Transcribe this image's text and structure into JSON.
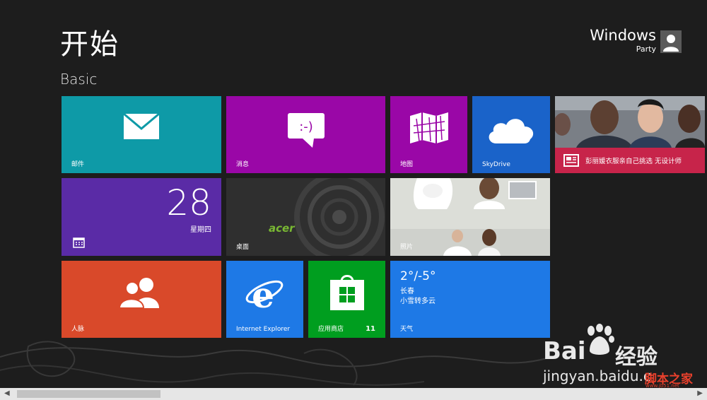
{
  "start": {
    "title": "开始",
    "group_title": "Basic"
  },
  "user": {
    "name": "Windows",
    "subtitle": "Party"
  },
  "tiles": {
    "mail": {
      "label": "邮件",
      "color": "#0e9aa7",
      "icon": "envelope-icon"
    },
    "messaging": {
      "label": "消息",
      "color": "#9a07a7",
      "icon": "speech-bubble-icon"
    },
    "maps": {
      "label": "地图",
      "color": "#9a07a7",
      "icon": "folded-map-icon"
    },
    "skydrive": {
      "label": "SkyDrive",
      "color": "#1a63c9",
      "icon": "cloud-icon"
    },
    "news": {
      "headline": "彭丽媛衣服亲自己挑选 无设计师",
      "color": "#c7244a",
      "icon": "newspaper-icon"
    },
    "calendar": {
      "day": "28",
      "weekday": "星期四",
      "color": "#5a2ba6",
      "icon": "calendar-icon"
    },
    "desktop": {
      "label": "桌面",
      "brand": "acer",
      "color": "#2f2f2f"
    },
    "photos": {
      "label": "照片",
      "color": "#d7d9d4"
    },
    "people": {
      "label": "人脉",
      "color": "#d9492a",
      "icon": "people-icon"
    },
    "ie": {
      "label": "Internet Explorer",
      "color": "#1e79e6",
      "icon": "internet-explorer-icon"
    },
    "store": {
      "label": "应用商店",
      "badge": "11",
      "color": "#009e1f",
      "icon": "store-bag-icon"
    },
    "weather": {
      "label": "天气",
      "temp": "2°/-5°",
      "city": "长春",
      "condition": "小雪转多云",
      "color": "#1e79e6"
    }
  },
  "watermark": {
    "baidu": "Bai",
    "jingyan": "经验",
    "url": "jingyan.baidu.c",
    "site": "脚本之家",
    "site_url": "www.jb51.net"
  },
  "scrollbar": {
    "left_arrow": "◀",
    "right_arrow": "▶"
  }
}
